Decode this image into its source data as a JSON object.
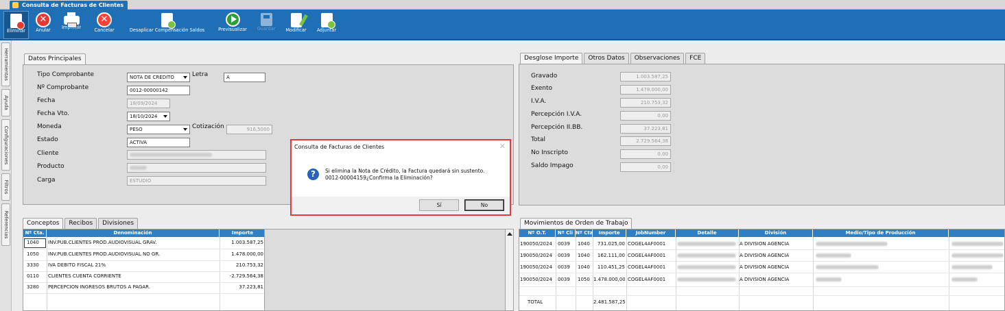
{
  "window_title": "Consulta de Facturas de Clientes",
  "toolbar": [
    {
      "id": "eliminar",
      "label": "Eliminar",
      "icon": "delete-doc-icon"
    },
    {
      "id": "anular",
      "label": "Anular",
      "icon": "cancel-x-icon"
    },
    {
      "id": "imprimir",
      "label": "Imprimir",
      "icon": "printer-icon"
    },
    {
      "id": "cancelar",
      "label": "Cancelar",
      "icon": "cancel-circle-icon"
    },
    {
      "id": "desaplicar",
      "label": "Desaplicar Compensación Saldos",
      "icon": "unapply-doc-icon"
    },
    {
      "id": "previsualizar",
      "label": "Previsualizar",
      "icon": "play-icon"
    },
    {
      "id": "guardar",
      "label": "Guardar",
      "icon": "save-disk-icon"
    },
    {
      "id": "modificar",
      "label": "Modificar",
      "icon": "edit-doc-icon"
    },
    {
      "id": "adjuntar",
      "label": "Adjuntar",
      "icon": "attach-doc-icon"
    }
  ],
  "sidebar_tabs": [
    "Herramientas",
    "Ayuda",
    "Configuraciones",
    "Filtros",
    "Referencias"
  ],
  "datos": {
    "tab": "Datos Principales",
    "tipo_comprobante_label": "Tipo Comprobante",
    "tipo_comprobante": "NOTA DE CREDITO",
    "letra_label": "Letra",
    "letra": "A",
    "nro_comprobante_label": "Nº Comprobante",
    "nro_comprobante": "0012-00000142",
    "fecha_label": "Fecha",
    "fecha": "18/09/2024",
    "fecha_vto_label": "Fecha Vto.",
    "fecha_vto": "18/10/2024",
    "moneda_label": "Moneda",
    "moneda": "PESO",
    "cotizacion_label": "Cotización",
    "cotizacion": "916,5000",
    "estado_label": "Estado",
    "estado": "ACTIVA",
    "cliente_label": "Cliente",
    "producto_label": "Producto",
    "carga_label": "Carga",
    "carga": "ESTUDIO"
  },
  "desglose": {
    "tabs": [
      "Desglose Importe",
      "Otros Datos",
      "Observaciones",
      "FCE"
    ],
    "rows": [
      {
        "label": "Gravado",
        "value": "1.003.587,25"
      },
      {
        "label": "Exento",
        "value": "1.478.000,00"
      },
      {
        "label": "I.V.A.",
        "value": "210.753,32"
      },
      {
        "label": "Percepción I.V.A.",
        "value": "0,00"
      },
      {
        "label": "Percepción II.BB.",
        "value": "37.223,81"
      },
      {
        "label": "Total",
        "value": "2.729.564,38"
      },
      {
        "label": "No Inscripto",
        "value": "0,00"
      },
      {
        "label": "Saldo Impago",
        "value": "0,00"
      }
    ]
  },
  "conceptos": {
    "tabs": [
      "Conceptos",
      "Recibos",
      "Divisiones"
    ],
    "headers": [
      "Nº Cta.",
      "Denominación",
      "Importe"
    ],
    "rows": [
      {
        "cta": "1040",
        "den": "INV.PUB.CLIENTES PROD.AUDIOVISUAL GRAV.",
        "imp": "1.003.587,25"
      },
      {
        "cta": "1050",
        "den": "INV.PUB.CLIENTES PROD.AUDIOVISUAL NO GR.",
        "imp": "1.478.000,00"
      },
      {
        "cta": "3330",
        "den": "IVA DEBITO FISCAL 21%",
        "imp": "210.753,32"
      },
      {
        "cta": "0110",
        "den": "CLIENTES CUENTA CORRIENTE",
        "imp": "-2.729.564,38"
      },
      {
        "cta": "3280",
        "den": "PERCEPCION INGRESOS BRUTOS A PAGAR.",
        "imp": "37.223,81"
      }
    ]
  },
  "movimientos": {
    "tab": "Movimientos de Orden de Trabajo",
    "headers": [
      "Nº O.T.",
      "Nº Cli",
      "Nº Cta",
      "Importe",
      "JobNumber",
      "Detalle",
      "División",
      "Medio/Tipo de Producción"
    ],
    "rows": [
      {
        "ot": "190050/2024",
        "cli": "0039",
        "cta": "1040",
        "imp": "731.025,00",
        "job": "COGEL4AF0001",
        "div": "A DIVISION AGENCIA"
      },
      {
        "ot": "190050/2024",
        "cli": "0039",
        "cta": "1040",
        "imp": "162.111,00",
        "job": "COGEL4AF0001",
        "div": "A DIVISION AGENCIA"
      },
      {
        "ot": "190050/2024",
        "cli": "0039",
        "cta": "1040",
        "imp": "110.451,25",
        "job": "COGEL4AF0001",
        "div": "A DIVISION AGENCIA"
      },
      {
        "ot": "190050/2024",
        "cli": "0039",
        "cta": "1050",
        "imp": "1.478.000,00",
        "job": "COGEL4AF0001",
        "div": "A DIVISION AGENCIA"
      }
    ],
    "total_label": "TOTAL",
    "total": "2.481.587,25"
  },
  "dialog": {
    "title": "Consulta de Facturas de Clientes",
    "line1": "Si elimina la Nota de Crédito, la Factura quedará sin sustento.",
    "line2": "0012-00004159¿Confirma la Eliminación?",
    "yes": "Sí",
    "no": "No"
  }
}
